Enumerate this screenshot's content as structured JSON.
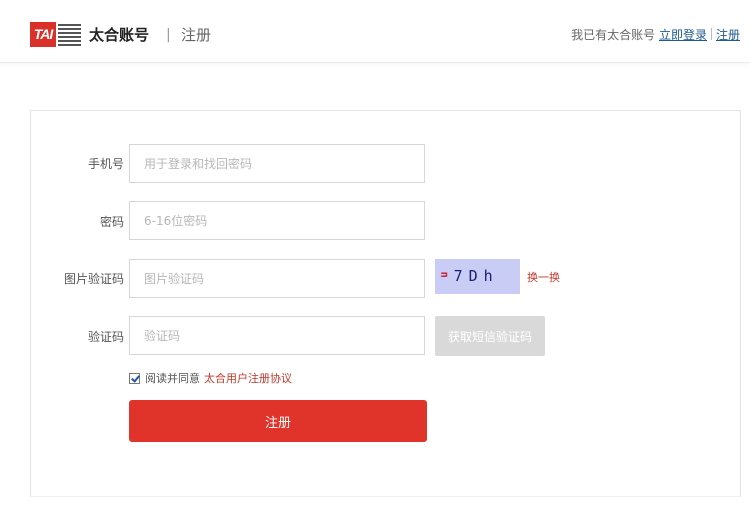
{
  "header": {
    "logo_text": "TAI",
    "brand": "太合账号",
    "separator": "|",
    "page_title": "注册",
    "have_account_text": "我已有太合账号",
    "login_link": "立即登录",
    "register_link": "注册"
  },
  "form": {
    "phone": {
      "label": "手机号",
      "placeholder": "用于登录和找回密码"
    },
    "password": {
      "label": "密码",
      "placeholder": "6-16位密码"
    },
    "image_code": {
      "label": "图片验证码",
      "placeholder": "图片验证码",
      "captcha_text": "7Dh",
      "refresh_label": "换一换"
    },
    "sms_code": {
      "label": "验证码",
      "placeholder": "验证码",
      "send_button": "获取短信验证码"
    },
    "agreement": {
      "checked": true,
      "text": "阅读并同意",
      "link": "太合用户注册协议"
    },
    "submit_label": "注册"
  },
  "colors": {
    "brand_red": "#e0332a",
    "link_blue": "#1f5b8f",
    "captcha_bg": "#c9cdf5",
    "disabled_button": "#d9d9d9"
  }
}
